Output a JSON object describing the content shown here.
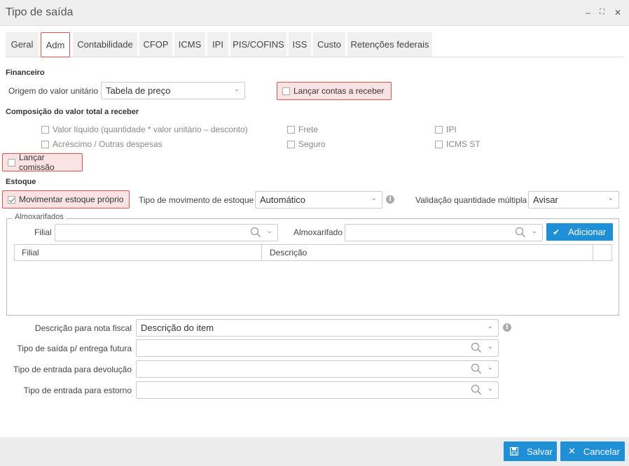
{
  "window": {
    "title": "Tipo de saída",
    "minimize": "‒",
    "maximize": "⛶",
    "close": "✕"
  },
  "tabs": [
    {
      "label": "Geral"
    },
    {
      "label": "Adm"
    },
    {
      "label": "Contabilidade"
    },
    {
      "label": "CFOP"
    },
    {
      "label": "ICMS"
    },
    {
      "label": "IPI"
    },
    {
      "label": "PIS/COFINS"
    },
    {
      "label": "ISS"
    },
    {
      "label": "Custo"
    },
    {
      "label": "Retenções federais"
    }
  ],
  "financeiro": {
    "title": "Financeiro",
    "origem_label": "Origem do valor unitário",
    "origem_value": "Tabela de preço",
    "lancar_contas": "Lançar contas a receber"
  },
  "composicao": {
    "title": "Composição do valor total a receber",
    "valor_liquido": "Valor líquido (quantidade * valor unitário – desconto)",
    "acrescimo": "Acréscimo / Outras despesas",
    "frete": "Frete",
    "seguro": "Seguro",
    "ipi": "IPI",
    "icms_st": "ICMS ST"
  },
  "lancar_comissao": "Lançar comissão",
  "estoque": {
    "title": "Estoque",
    "movimentar": "Movimentar estoque próprio",
    "tipo_mov_label": "Tipo de movimento de estoque",
    "tipo_mov_value": "Automático",
    "validacao_label": "Validação quantidade múltipla",
    "validacao_value": "Avisar"
  },
  "almoxarifados": {
    "legend": "Almoxarifados",
    "filial_label": "Filial",
    "almox_label": "Almoxarifado",
    "add_button": "Adicionar",
    "columns": [
      "Filial",
      "Descrição"
    ]
  },
  "fields": {
    "descricao_nf_label": "Descrição para nota fiscal",
    "descricao_nf_value": "Descrição do item",
    "saida_futura_label": "Tipo de saída p/ entrega futura",
    "entrada_devolucao_label": "Tipo de entrada para devolução",
    "entrada_estorno_label": "Tipo de entrada para estorno"
  },
  "footer": {
    "save": "Salvar",
    "cancel": "Cancelar"
  },
  "colors": {
    "accent": "#1f8fd6",
    "highlight_border": "#d9534f",
    "highlight_bg": "#fbe3e4"
  }
}
